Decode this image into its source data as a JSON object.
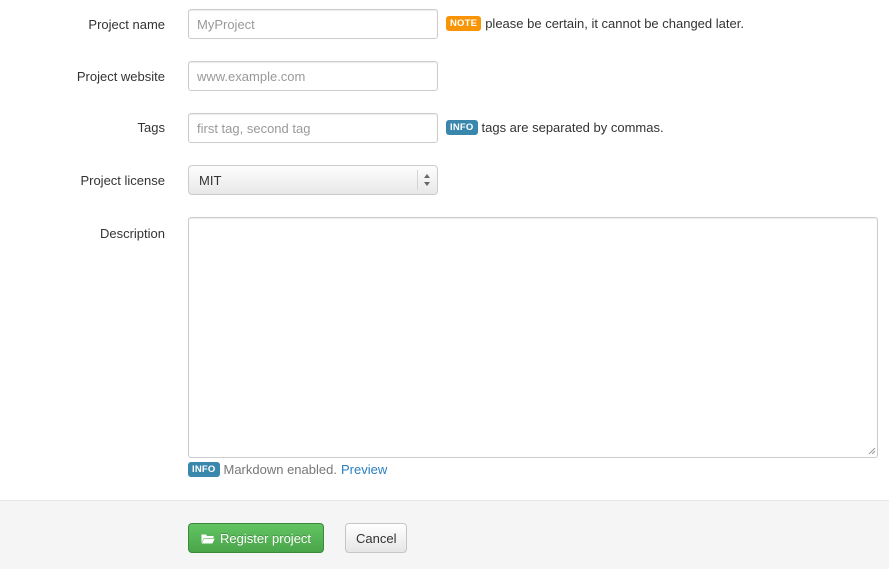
{
  "form": {
    "project_name": {
      "label": "Project name",
      "placeholder": "MyProject",
      "value": "",
      "note_badge": "NOTE",
      "note_text": "please be certain, it cannot be changed later."
    },
    "project_website": {
      "label": "Project website",
      "placeholder": "www.example.com",
      "value": ""
    },
    "tags": {
      "label": "Tags",
      "placeholder": "first tag, second tag",
      "value": "",
      "info_badge": "INFO",
      "info_text": "tags are separated by commas."
    },
    "project_license": {
      "label": "Project license",
      "selected": "MIT"
    },
    "description": {
      "label": "Description",
      "value": "",
      "info_badge": "INFO",
      "info_text": "Markdown enabled.",
      "preview_link": "Preview"
    }
  },
  "footer": {
    "register_label": "Register project",
    "register_icon": "folder-open-icon",
    "cancel_label": "Cancel"
  },
  "colors": {
    "note_badge": "#f89406",
    "info_badge": "#3a87ad",
    "primary_button": "#51a351",
    "link": "#2a7fc0",
    "footer_bg": "#f5f5f5"
  }
}
